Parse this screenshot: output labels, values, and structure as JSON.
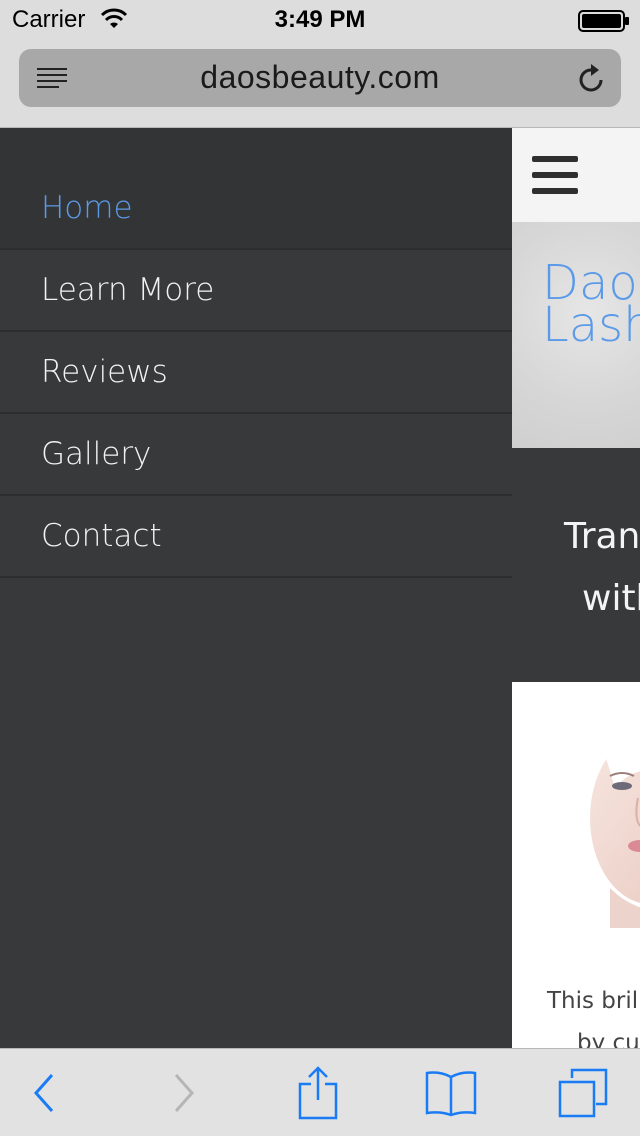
{
  "status_bar": {
    "carrier": "Carrier",
    "time": "3:49 PM"
  },
  "browser": {
    "url": "daosbeauty.com"
  },
  "menu": {
    "items": [
      {
        "label": "Home",
        "active": true
      },
      {
        "label": "Learn More"
      },
      {
        "label": "Reviews"
      },
      {
        "label": "Gallery"
      },
      {
        "label": "Contact"
      }
    ]
  },
  "page": {
    "logo_line1": "Dao'",
    "logo_line2": "Lash",
    "tagline_line1": "Tran",
    "tagline_line2": "with",
    "body_line1": "This brill",
    "body_line2": "by cu"
  },
  "colors": {
    "accent": "#5b9ae8",
    "menu_bg": "#38393b",
    "ios_blue": "#1a7cf5"
  },
  "icons": [
    "wifi-icon",
    "battery-icon",
    "reader-icon",
    "reload-icon",
    "hamburger-icon",
    "back-icon",
    "forward-icon",
    "share-icon",
    "bookmarks-icon",
    "tabs-icon"
  ]
}
